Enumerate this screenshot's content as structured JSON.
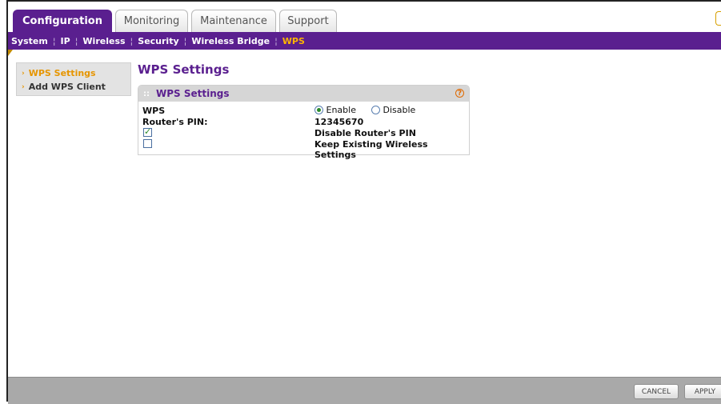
{
  "tabs": [
    {
      "label": "Configuration",
      "active": true
    },
    {
      "label": "Monitoring",
      "active": false
    },
    {
      "label": "Maintenance",
      "active": false
    },
    {
      "label": "Support",
      "active": false
    }
  ],
  "subnav": {
    "items": [
      "System",
      "IP",
      "Wireless",
      "Security",
      "Wireless Bridge",
      "WPS"
    ],
    "active": "WPS"
  },
  "sidebar": {
    "items": [
      {
        "label": "WPS Settings",
        "active": true
      },
      {
        "label": "Add WPS Client",
        "active": false
      }
    ]
  },
  "page": {
    "title": "WPS Settings"
  },
  "panel": {
    "title": "WPS Settings",
    "help_icon": "?",
    "wps_label": "WPS",
    "enable_label": "Enable",
    "disable_label": "Disable",
    "wps_value": "Enable",
    "pin_label": "Router's PIN:",
    "pin_value": "12345670",
    "disable_pin_label": "Disable Router's PIN",
    "disable_pin_checked": true,
    "keep_settings_label": "Keep Existing Wireless Settings",
    "keep_settings_checked": false
  },
  "footer": {
    "cancel_label": "CANCEL",
    "apply_label": "APPLY"
  },
  "colors": {
    "brand_purple": "#5a1f8f",
    "accent_orange": "#e69500",
    "active_subnav": "#ffb400"
  }
}
